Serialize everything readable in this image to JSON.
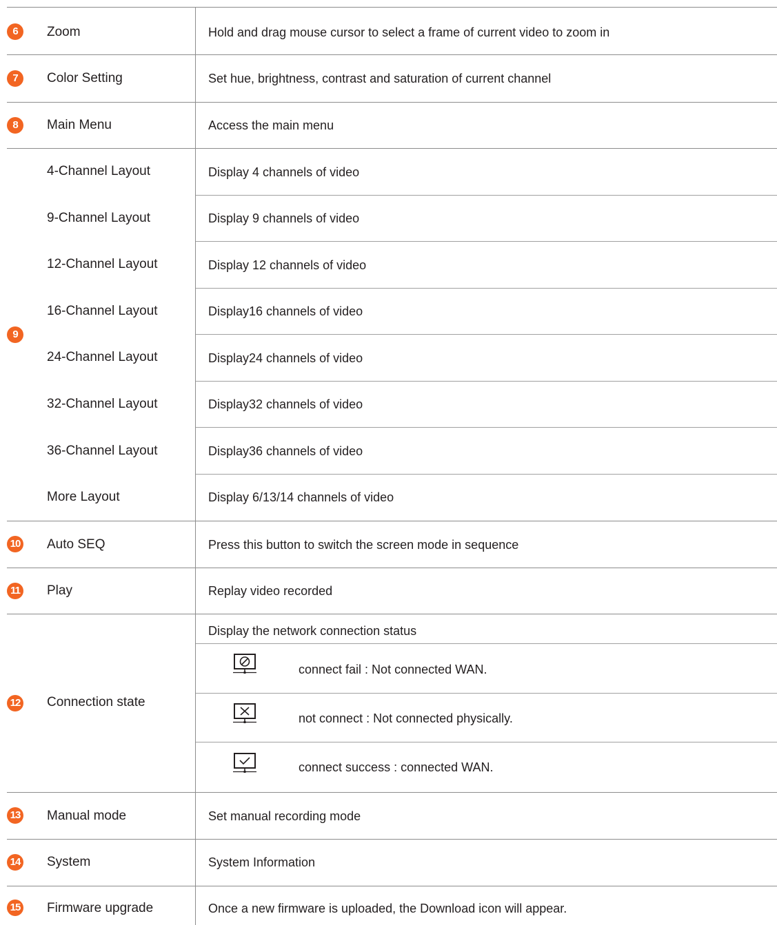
{
  "rows": [
    {
      "badge": "6",
      "name": "Zoom",
      "desc": "Hold and drag mouse cursor to select a frame of current video to zoom in"
    },
    {
      "badge": "7",
      "name": "Color Setting",
      "desc": "Set hue, brightness, contrast and saturation of current channel"
    },
    {
      "badge": "8",
      "name": "Main Menu",
      "desc": "Access the main menu"
    }
  ],
  "layouts": {
    "badge": "9",
    "items": [
      {
        "name": "4-Channel Layout",
        "desc": "Display 4 channels of video"
      },
      {
        "name": "9-Channel Layout",
        "desc": "Display 9 channels of video"
      },
      {
        "name": "12-Channel Layout",
        "desc": "Display 12 channels of video"
      },
      {
        "name": "16-Channel Layout",
        "desc": "Display16 channels of video"
      },
      {
        "name": "24-Channel Layout",
        "desc": "Display24 channels of video"
      },
      {
        "name": "32-Channel Layout",
        "desc": "Display32 channels of video"
      },
      {
        "name": "36-Channel Layout",
        "desc": "Display36 channels of video"
      },
      {
        "name": "More Layout",
        "desc": "Display 6/13/14 channels of video"
      }
    ]
  },
  "rows2": [
    {
      "badge": "10",
      "name": "Auto SEQ",
      "desc": "Press this button to switch the screen mode in sequence"
    },
    {
      "badge": "11",
      "name": "Play",
      "desc": "Replay video recorded"
    }
  ],
  "connection": {
    "badge": "12",
    "name": "Connection state",
    "desc": "Display the network connection status",
    "states": [
      {
        "icon": "connect-fail-icon",
        "desc": "connect fail : Not connected WAN."
      },
      {
        "icon": "not-connect-icon",
        "desc": "not connect : Not connected physically."
      },
      {
        "icon": "connect-success-icon",
        "desc": "connect success : connected WAN."
      }
    ]
  },
  "rows3": [
    {
      "badge": "13",
      "name": "Manual mode",
      "desc": "Set manual recording mode"
    },
    {
      "badge": "14",
      "name": "System",
      "desc": "System Information"
    },
    {
      "badge": "15",
      "name": "Firmware upgrade",
      "desc": "Once a new firmware is uploaded, the Download icon will appear."
    }
  ],
  "colors": {
    "badge": "#f26522",
    "text": "#231f20",
    "rule": "#8c8c8c"
  }
}
